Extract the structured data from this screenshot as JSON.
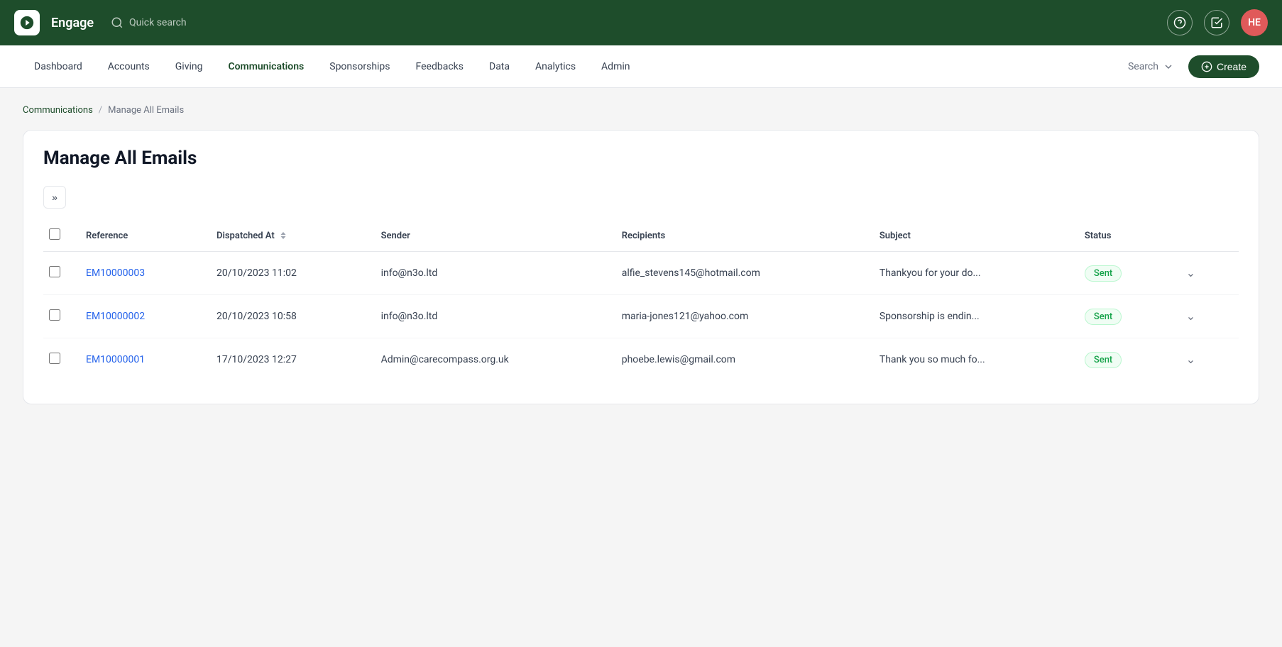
{
  "app": {
    "name": "Engage",
    "logo_alt": "Engage logo"
  },
  "topbar": {
    "search_placeholder": "Quick search",
    "help_icon": "question-circle",
    "tasks_icon": "checkbox",
    "user_initials": "HE"
  },
  "navbar": {
    "items": [
      {
        "label": "Dashboard",
        "active": false
      },
      {
        "label": "Accounts",
        "active": false
      },
      {
        "label": "Giving",
        "active": false
      },
      {
        "label": "Communications",
        "active": true
      },
      {
        "label": "Sponsorships",
        "active": false
      },
      {
        "label": "Feedbacks",
        "active": false
      },
      {
        "label": "Data",
        "active": false
      },
      {
        "label": "Analytics",
        "active": false
      },
      {
        "label": "Admin",
        "active": false
      }
    ],
    "search_label": "Search",
    "create_label": "Create"
  },
  "breadcrumb": {
    "parent": "Communications",
    "current": "Manage All Emails"
  },
  "page": {
    "title": "Manage All Emails"
  },
  "table": {
    "columns": [
      {
        "key": "reference",
        "label": "Reference"
      },
      {
        "key": "dispatched_at",
        "label": "Dispatched At",
        "sortable": true
      },
      {
        "key": "sender",
        "label": "Sender"
      },
      {
        "key": "recipients",
        "label": "Recipients"
      },
      {
        "key": "subject",
        "label": "Subject"
      },
      {
        "key": "status",
        "label": "Status"
      }
    ],
    "rows": [
      {
        "reference": "EM10000003",
        "dispatched_at": "20/10/2023 11:02",
        "sender": "info@n3o.ltd",
        "recipients": "alfie_stevens145@hotmail.com",
        "subject": "Thankyou for your do...",
        "status": "Sent"
      },
      {
        "reference": "EM10000002",
        "dispatched_at": "20/10/2023 10:58",
        "sender": "info@n3o.ltd",
        "recipients": "maria-jones121@yahoo.com",
        "subject": "Sponsorship is endin...",
        "status": "Sent"
      },
      {
        "reference": "EM10000001",
        "dispatched_at": "17/10/2023 12:27",
        "sender": "Admin@carecompass.org.uk",
        "recipients": "phoebe.lewis@gmail.com",
        "subject": "Thank you so much fo...",
        "status": "Sent"
      }
    ]
  }
}
